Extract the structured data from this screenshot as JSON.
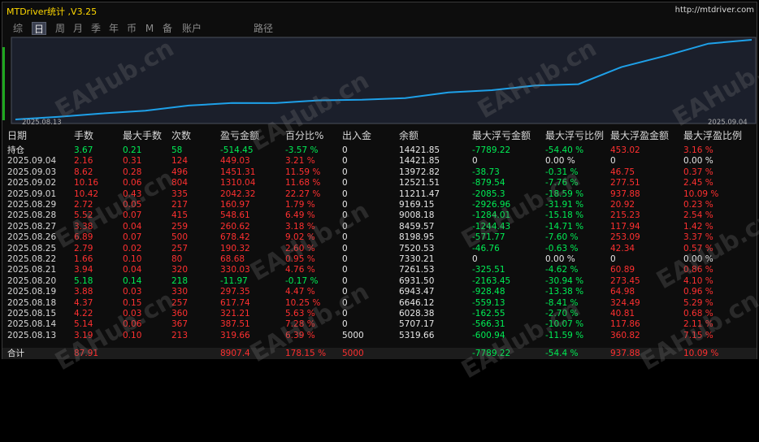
{
  "window": {
    "title": "MTDriver统计 ,V3.25",
    "url": "http://mtdriver.com"
  },
  "tabs": [
    "综",
    "日",
    "周",
    "月",
    "季",
    "年",
    "币",
    "M",
    "备",
    "账户",
    "路径"
  ],
  "active_tab": "日",
  "chart": {
    "start_label": "2025.08.13",
    "end_label": "2025.09.04",
    "line_color": "#1ea0e8"
  },
  "columns": [
    "日期",
    "手数",
    "最大手数",
    "次数",
    "盈亏金额",
    "百分比%",
    "出入金",
    "余额",
    "最大浮亏金额",
    "最大浮亏比例",
    "最大浮盈金额",
    "最大浮盈比例"
  ],
  "rows": [
    {
      "date": "持仓",
      "lots": "3.67",
      "maxlots": "0.21",
      "count": "58",
      "pnl": "-514.45",
      "pct": "-3.57 %",
      "io": "0",
      "bal": "14421.85",
      "mfl": "-7789.22",
      "mflp": "-54.40 %",
      "mfp": "453.02",
      "mfpp": "3.16 %",
      "color": "green"
    },
    {
      "date": "2025.09.04",
      "lots": "2.16",
      "maxlots": "0.31",
      "count": "124",
      "pnl": "449.03",
      "pct": "3.21 %",
      "io": "0",
      "bal": "14421.85",
      "mfl": "0",
      "mflp": "0.00 %",
      "mfp": "0",
      "mfpp": "0.00 %",
      "color": "red"
    },
    {
      "date": "2025.09.03",
      "lots": "8.62",
      "maxlots": "0.28",
      "count": "496",
      "pnl": "1451.31",
      "pct": "11.59 %",
      "io": "0",
      "bal": "13972.82",
      "mfl": "-38.73",
      "mflp": "-0.31 %",
      "mfp": "46.75",
      "mfpp": "0.37 %",
      "color": "red"
    },
    {
      "date": "2025.09.02",
      "lots": "10.16",
      "maxlots": "0.06",
      "count": "804",
      "pnl": "1310.04",
      "pct": "11.68 %",
      "io": "0",
      "bal": "12521.51",
      "mfl": "-879.54",
      "mflp": "-7.76 %",
      "mfp": "277.51",
      "mfpp": "2.45 %",
      "color": "red"
    },
    {
      "date": "2025.09.01",
      "lots": "10.42",
      "maxlots": "0.43",
      "count": "335",
      "pnl": "2042.32",
      "pct": "22.27 %",
      "io": "0",
      "bal": "11211.47",
      "mfl": "-2085.3",
      "mflp": "-18.59 %",
      "mfp": "937.88",
      "mfpp": "10.09 %",
      "color": "red"
    },
    {
      "date": "2025.08.29",
      "lots": "2.72",
      "maxlots": "0.05",
      "count": "217",
      "pnl": "160.97",
      "pct": "1.79 %",
      "io": "0",
      "bal": "9169.15",
      "mfl": "-2926.96",
      "mflp": "-31.91 %",
      "mfp": "20.92",
      "mfpp": "0.23 %",
      "color": "red"
    },
    {
      "date": "2025.08.28",
      "lots": "5.52",
      "maxlots": "0.07",
      "count": "415",
      "pnl": "548.61",
      "pct": "6.49 %",
      "io": "0",
      "bal": "9008.18",
      "mfl": "-1284.01",
      "mflp": "-15.18 %",
      "mfp": "215.23",
      "mfpp": "2.54 %",
      "color": "red"
    },
    {
      "date": "2025.08.27",
      "lots": "3.38",
      "maxlots": "0.04",
      "count": "259",
      "pnl": "260.62",
      "pct": "3.18 %",
      "io": "0",
      "bal": "8459.57",
      "mfl": "-1244.43",
      "mflp": "-14.71 %",
      "mfp": "117.94",
      "mfpp": "1.42 %",
      "color": "red"
    },
    {
      "date": "2025.08.26",
      "lots": "6.89",
      "maxlots": "0.07",
      "count": "500",
      "pnl": "678.42",
      "pct": "9.02 %",
      "io": "0",
      "bal": "8198.95",
      "mfl": "-571.77",
      "mflp": "-7.60 %",
      "mfp": "253.09",
      "mfpp": "3.37 %",
      "color": "red"
    },
    {
      "date": "2025.08.25",
      "lots": "2.79",
      "maxlots": "0.02",
      "count": "257",
      "pnl": "190.32",
      "pct": "2.60 %",
      "io": "0",
      "bal": "7520.53",
      "mfl": "-46.76",
      "mflp": "-0.63 %",
      "mfp": "42.34",
      "mfpp": "0.57 %",
      "color": "red"
    },
    {
      "date": "2025.08.22",
      "lots": "1.66",
      "maxlots": "0.10",
      "count": "80",
      "pnl": "68.68",
      "pct": "0.95 %",
      "io": "0",
      "bal": "7330.21",
      "mfl": "0",
      "mflp": "0.00 %",
      "mfp": "0",
      "mfpp": "0.00 %",
      "color": "red"
    },
    {
      "date": "2025.08.21",
      "lots": "3.94",
      "maxlots": "0.04",
      "count": "320",
      "pnl": "330.03",
      "pct": "4.76 %",
      "io": "0",
      "bal": "7261.53",
      "mfl": "-325.51",
      "mflp": "-4.62 %",
      "mfp": "60.89",
      "mfpp": "0.86 %",
      "color": "red"
    },
    {
      "date": "2025.08.20",
      "lots": "5.18",
      "maxlots": "0.14",
      "count": "218",
      "pnl": "-11.97",
      "pct": "-0.17 %",
      "io": "0",
      "bal": "6931.50",
      "mfl": "-2163.45",
      "mflp": "-30.94 %",
      "mfp": "273.45",
      "mfpp": "4.10 %",
      "color": "green"
    },
    {
      "date": "2025.08.19",
      "lots": "3.88",
      "maxlots": "0.03",
      "count": "330",
      "pnl": "297.35",
      "pct": "4.47 %",
      "io": "0",
      "bal": "6943.47",
      "mfl": "-928.48",
      "mflp": "-13.38 %",
      "mfp": "64.98",
      "mfpp": "0.96 %",
      "color": "red"
    },
    {
      "date": "2025.08.18",
      "lots": "4.37",
      "maxlots": "0.15",
      "count": "257",
      "pnl": "617.74",
      "pct": "10.25 %",
      "io": "0",
      "bal": "6646.12",
      "mfl": "-559.13",
      "mflp": "-8.41 %",
      "mfp": "324.49",
      "mfpp": "5.29 %",
      "color": "red"
    },
    {
      "date": "2025.08.15",
      "lots": "4.22",
      "maxlots": "0.03",
      "count": "360",
      "pnl": "321.21",
      "pct": "5.63 %",
      "io": "0",
      "bal": "6028.38",
      "mfl": "-162.55",
      "mflp": "-2.70 %",
      "mfp": "40.81",
      "mfpp": "0.68 %",
      "color": "red"
    },
    {
      "date": "2025.08.14",
      "lots": "5.14",
      "maxlots": "0.06",
      "count": "367",
      "pnl": "387.51",
      "pct": "7.28 %",
      "io": "0",
      "bal": "5707.17",
      "mfl": "-566.31",
      "mflp": "-10.07 %",
      "mfp": "117.86",
      "mfpp": "2.11 %",
      "color": "red"
    },
    {
      "date": "2025.08.13",
      "lots": "3.19",
      "maxlots": "0.10",
      "count": "213",
      "pnl": "319.66",
      "pct": "6.39 %",
      "io": "5000",
      "bal": "5319.66",
      "mfl": "-600.94",
      "mflp": "-11.59 %",
      "mfp": "360.82",
      "mfpp": "7.15 %",
      "color": "red"
    }
  ],
  "total": {
    "date": "合计",
    "lots": "87.91",
    "maxlots": "",
    "count": "",
    "pnl": "8907.4",
    "pct": "178.15 %",
    "io": "5000",
    "bal": "",
    "mfl": "-7789.22",
    "mflp": "-54.4 %",
    "mfp": "937.88",
    "mfpp": "10.09 %"
  },
  "watermark": "EAHub.cn"
}
